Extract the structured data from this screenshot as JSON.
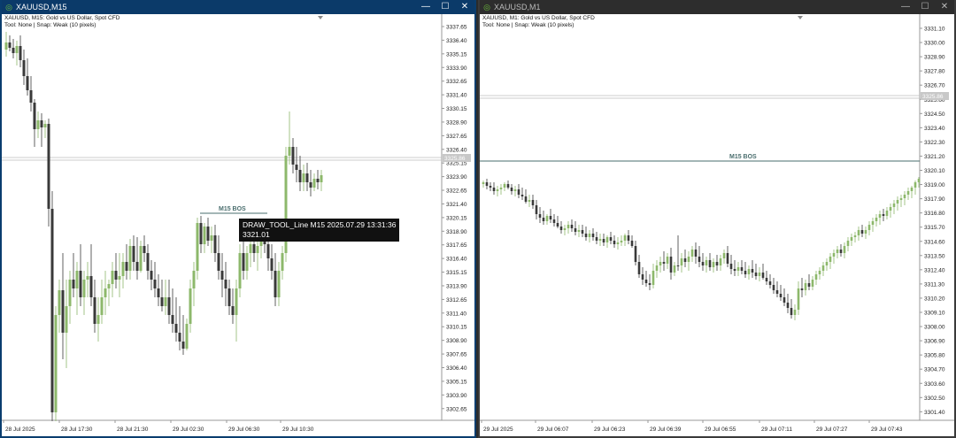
{
  "left": {
    "title": "XAUUSD,M15",
    "info_line1": "XAUUSD, M15:  Gold vs US Dollar, Spot CFD",
    "info_line2": "Tool: None | Snap: Weak (10 pixels)",
    "bos_label": "M15 BOS",
    "tooltip_line1": "DRAW_TOOL_Line M15 2025.07.29 13:31:36",
    "tooltip_line2": "3321.01",
    "current_price_label": "3325.86",
    "price_ticks": [
      "3337.65",
      "3336.40",
      "3335.15",
      "3333.90",
      "3332.65",
      "3331.40",
      "3330.15",
      "3328.90",
      "3327.65",
      "3326.40",
      "3325.15",
      "3323.90",
      "3322.65",
      "3321.40",
      "3320.15",
      "3318.90",
      "3317.65",
      "3316.40",
      "3315.15",
      "3313.90",
      "3312.65",
      "3311.40",
      "3310.15",
      "3308.90",
      "3307.65",
      "3306.40",
      "3305.15",
      "3303.90",
      "3302.65"
    ],
    "time_ticks": [
      "28 Jul 2025",
      "28 Jul 17:30",
      "28 Jul 21:30",
      "29 Jul 02:30",
      "29 Jul 06:30",
      "29 Jul 10:30"
    ]
  },
  "right": {
    "title": "XAUUSD,M1",
    "info_line1": "XAUUSD, M1:  Gold vs US Dollar, Spot CFD",
    "info_line2": "Tool: None | Snap: Weak (10 pixels)",
    "bos_label": "M15 BOS",
    "current_price_label": "3325.86",
    "price_ticks": [
      "3331.10",
      "3330.00",
      "3328.90",
      "3327.80",
      "3326.70",
      "3325.60",
      "3324.50",
      "3323.40",
      "3322.30",
      "3321.20",
      "3320.10",
      "3319.00",
      "3317.90",
      "3316.80",
      "3315.70",
      "3314.60",
      "3313.50",
      "3312.40",
      "3311.30",
      "3310.20",
      "3309.10",
      "3308.00",
      "3306.90",
      "3305.80",
      "3304.70",
      "3303.60",
      "3302.50",
      "3301.40"
    ],
    "time_ticks": [
      "29 Jul 2025",
      "29 Jul 06:07",
      "29 Jul 06:23",
      "29 Jul 06:39",
      "29 Jul 06:55",
      "29 Jul 07:11",
      "29 Jul 07:27",
      "29 Jul 07:43"
    ]
  },
  "buttons": {
    "minimize": "—",
    "maximize": "☐",
    "close": "✕"
  },
  "colors": {
    "bull": "#8db86b",
    "bear": "#3a3a3a",
    "bos_line": "#4a6e6e",
    "accent_left": "#0b3a69"
  }
}
